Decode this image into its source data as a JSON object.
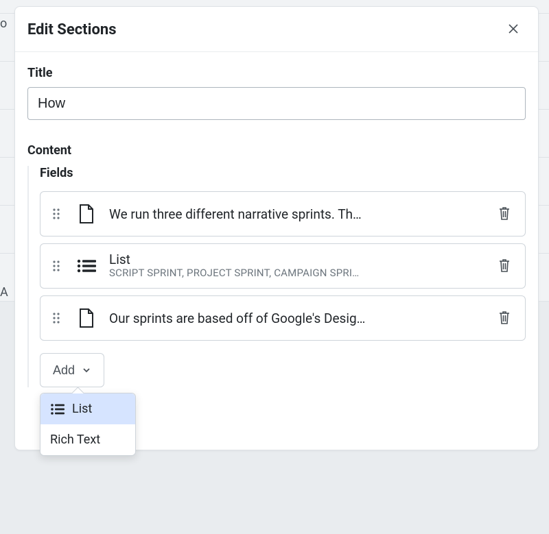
{
  "header": {
    "title": "Edit Sections"
  },
  "form": {
    "title_label": "Title",
    "title_value": "How",
    "content_label": "Content",
    "fields_label": "Fields"
  },
  "fields": [
    {
      "type": "richtext",
      "text": "We run three different narrative sprints. Th…"
    },
    {
      "type": "list",
      "title": "List",
      "subtitle": "SCRIPT SPRINT, PROJECT SPRINT, CAMPAIGN SPRI…"
    },
    {
      "type": "richtext",
      "text": "Our sprints are based off of Google's Desig…"
    }
  ],
  "add": {
    "label": "Add"
  },
  "dropdown": {
    "items": [
      {
        "label": "List",
        "icon": "list",
        "selected": true
      },
      {
        "label": "Rich Text",
        "icon": "none",
        "selected": false
      }
    ]
  },
  "bg": {
    "partial_text_left_o": "o",
    "partial_text_left_a": "A"
  }
}
